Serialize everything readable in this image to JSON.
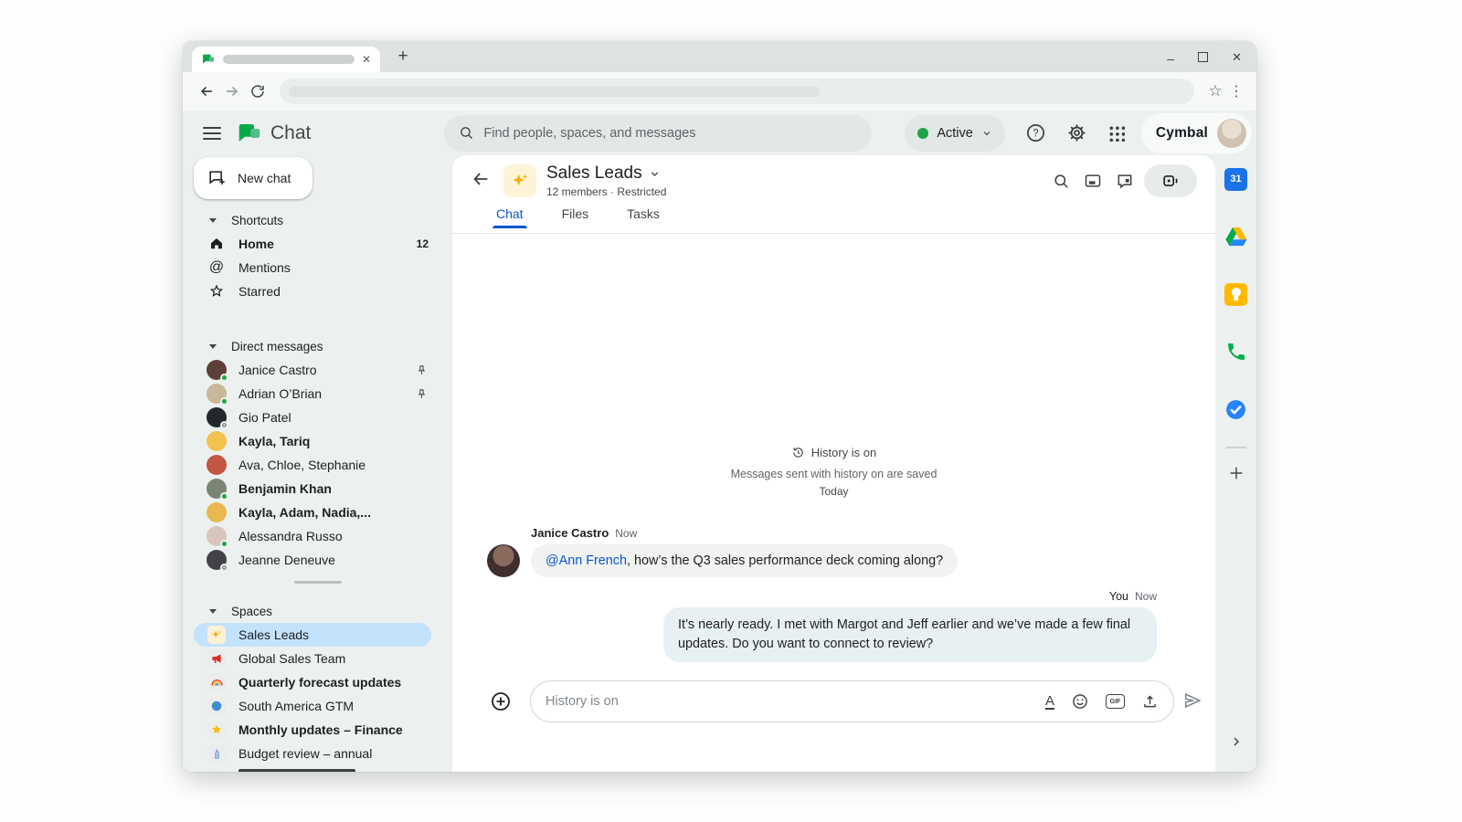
{
  "icons": {
    "tab_close": "✕",
    "new_tab": "+",
    "minimize": "–",
    "close_window": "✕",
    "bookmark_star": "☆",
    "overflow_menu": "⋮",
    "mentions_at": "@",
    "gif_label": "GIF",
    "format_a": "A",
    "calendar_day": "31"
  },
  "appbar": {
    "product_name": "Chat",
    "search_placeholder": "Find people, spaces, and messages",
    "status_label": "Active",
    "account_name": "Cymbal"
  },
  "sidebar": {
    "new_chat_label": "New chat",
    "shortcuts": {
      "header": "Shortcuts",
      "items": [
        {
          "label": "Home",
          "badge": "12"
        },
        {
          "label": "Mentions"
        },
        {
          "label": "Starred"
        }
      ]
    },
    "direct_messages": {
      "header": "Direct messages",
      "items": [
        {
          "label": "Janice Castro"
        },
        {
          "label": "Adrian O’Brian"
        },
        {
          "label": "Gio Patel"
        },
        {
          "label": "Kayla, Tariq"
        },
        {
          "label": "Ava, Chloe, Stephanie"
        },
        {
          "label": "Benjamin Khan"
        },
        {
          "label": "Kayla, Adam, Nadia,..."
        },
        {
          "label": "Alessandra Russo"
        },
        {
          "label": "Jeanne Deneuve"
        }
      ]
    },
    "spaces": {
      "header": "Spaces",
      "items": [
        {
          "label": "Sales Leads"
        },
        {
          "label": "Global Sales Team"
        },
        {
          "label": "Quarterly forecast updates"
        },
        {
          "label": "South America GTM"
        },
        {
          "label": "Monthly updates – Finance"
        },
        {
          "label": "Budget review – annual"
        }
      ]
    }
  },
  "space_header": {
    "title": "Sales Leads",
    "subtitle": "12 members · Restricted",
    "tabs": [
      {
        "label": "Chat"
      },
      {
        "label": "Files"
      },
      {
        "label": "Tasks"
      }
    ]
  },
  "conversation": {
    "history_title": "History is on",
    "history_subtitle": "Messages sent with history on are saved",
    "date_label": "Today",
    "messages": [
      {
        "sender": "Janice Castro",
        "time": "Now",
        "mention": "@Ann French",
        "text": ", how’s the Q3 sales performance deck coming along?"
      },
      {
        "sender": "You",
        "time": "Now",
        "text": "It’s nearly ready. I met with Margot and Jeff earlier and we’ve made a few final updates. Do you want to connect to review?"
      }
    ]
  },
  "composer": {
    "placeholder": "History is on"
  },
  "colors": {
    "accent_blue": "#0b57d0",
    "active_green": "#1ea446",
    "selected_space_bg": "#c3e2fc",
    "chat_brand_green": "#00ac47"
  }
}
